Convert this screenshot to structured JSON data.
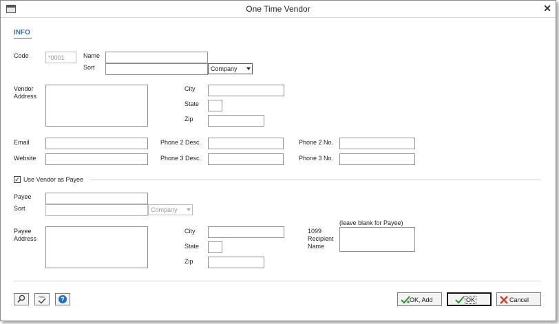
{
  "window": {
    "title": "One Time Vendor",
    "close_glyph": "✕",
    "app_icon": "window-icon"
  },
  "section": {
    "title": "INFO"
  },
  "vendor": {
    "code_label": "Code",
    "code_value": "*0001",
    "name_label": "Name",
    "name_value": "",
    "sort_label": "Sort",
    "sort_value": "",
    "sort_select": "Company",
    "address_label_1": "Vendor",
    "address_label_2": "Address",
    "address_value": "",
    "city_label": "City",
    "state_label": "State",
    "zip_label": "Zip",
    "email_label": "Email",
    "website_label": "Website",
    "phone2_desc_label": "Phone 2 Desc.",
    "phone3_desc_label": "Phone 3 Desc.",
    "phone2_no_label": "Phone 2 No.",
    "phone3_no_label": "Phone 3 No."
  },
  "use_vendor_as_payee": {
    "label": "Use Vendor as Payee",
    "checked": true,
    "check_glyph": "✓"
  },
  "payee": {
    "payee_label": "Payee",
    "sort_label": "Sort",
    "sort_select": "Company",
    "address_label_1": "Payee",
    "address_label_2": "Address",
    "city_label": "City",
    "state_label": "State",
    "zip_label": "Zip",
    "recipient_label_1": "1099",
    "recipient_label_2": "Recipient",
    "recipient_label_3": "Name",
    "recipient_hint": "(leave blank for Payee)"
  },
  "footer": {
    "icons": [
      "magnifier-icon",
      "spellcheck-icon",
      "help-icon"
    ],
    "spell_text": "ABC",
    "help_glyph": "?",
    "ok_add_label": "OK, Add",
    "ok_label": "OK",
    "cancel_label": "Cancel"
  },
  "colors": {
    "accent": "#2f75b5",
    "ok_check": "#1a9c2a",
    "cancel_x": "#d43a2a"
  }
}
